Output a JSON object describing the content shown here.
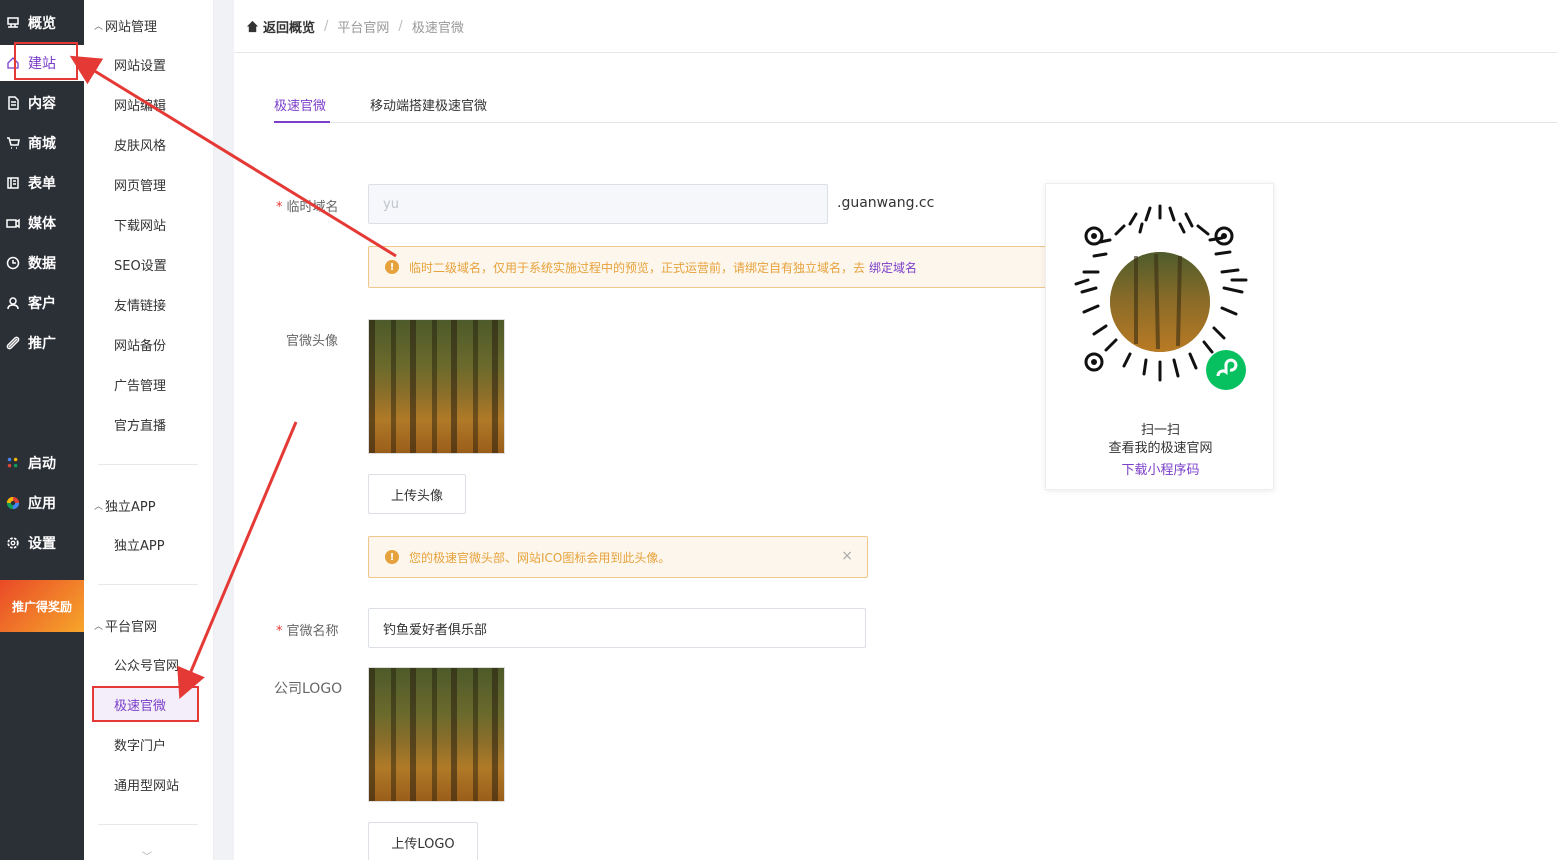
{
  "nav": {
    "items": [
      {
        "label": "概览",
        "icon": "overview-icon"
      },
      {
        "label": "建站",
        "icon": "home-icon"
      },
      {
        "label": "内容",
        "icon": "content-icon"
      },
      {
        "label": "商城",
        "icon": "cart-icon"
      },
      {
        "label": "表单",
        "icon": "form-icon"
      },
      {
        "label": "媒体",
        "icon": "media-icon"
      },
      {
        "label": "数据",
        "icon": "data-icon"
      },
      {
        "label": "客户",
        "icon": "customer-icon"
      },
      {
        "label": "推广",
        "icon": "promote-icon"
      }
    ],
    "bottom_items": [
      {
        "label": "启动",
        "icon": "launch-icon"
      },
      {
        "label": "应用",
        "icon": "apps-icon"
      },
      {
        "label": "设置",
        "icon": "settings-icon"
      }
    ],
    "promo_label": "推广得奖励"
  },
  "submenu": {
    "group1": {
      "title": "网站管理",
      "items": [
        "网站设置",
        "网站编辑",
        "皮肤风格",
        "网页管理",
        "下载网站",
        "SEO设置",
        "友情链接",
        "网站备份",
        "广告管理",
        "官方直播"
      ]
    },
    "group2": {
      "title": "独立APP",
      "items": [
        "独立APP"
      ]
    },
    "group3": {
      "title": "平台官网",
      "items": [
        "公众号官网",
        "极速官微",
        "数字门户",
        "通用型网站"
      ]
    }
  },
  "breadcrumb": {
    "home": "返回概览",
    "items": [
      "平台官网",
      "极速官微"
    ]
  },
  "tabs": [
    "极速官微",
    "移动端搭建极速官微"
  ],
  "form": {
    "domain_label": "临时域名",
    "domain_value": "yu",
    "domain_suffix": ".guanwang.cc",
    "domain_alert": "临时二级域名，仅用于系统实施过程中的预览，正式运营前，请绑定自有独立域名，去",
    "domain_alert_link": "绑定域名",
    "avatar_label": "官微头像",
    "avatar_button": "上传头像",
    "avatar_alert": "您的极速官微头部、网站ICO图标会用到此头像。",
    "name_label": "官微名称",
    "name_value": "钓鱼爱好者俱乐部",
    "logo_label": "公司LOGO",
    "logo_button": "上传LOGO"
  },
  "qr": {
    "line1": "扫一扫",
    "line2": "查看我的极速官网",
    "link": "下载小程序码"
  },
  "colors": {
    "accent": "#7b3fc9",
    "nav_bg": "#2b2f36",
    "warning": "#e6a23c",
    "annotation": "#e53935"
  }
}
